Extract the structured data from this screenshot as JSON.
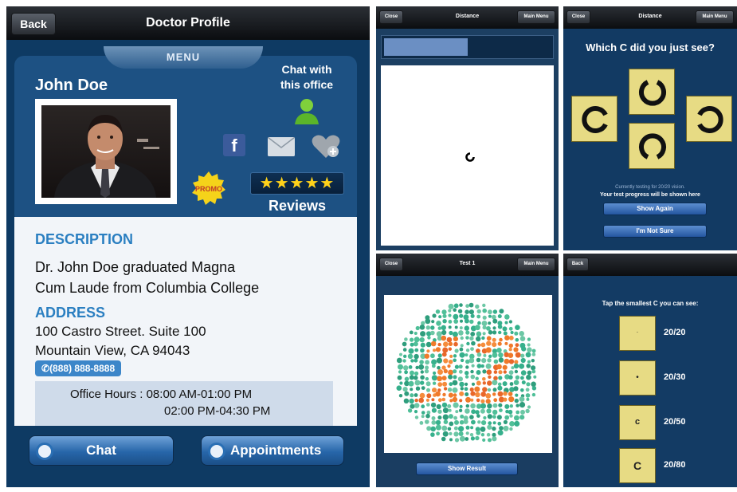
{
  "doctor_profile": {
    "nav": {
      "title": "Doctor Profile",
      "back_label": "Back"
    },
    "menu_label": "MENU",
    "name": "John Doe",
    "chat_with_office": [
      "Chat with",
      "this office"
    ],
    "promo_label": "PROMO",
    "rating": {
      "stars_text": "★★★★★",
      "value_out_of_5": 5,
      "label": "Reviews"
    },
    "description": {
      "heading": "DESCRIPTION",
      "lines": [
        "Dr. John Doe graduated Magna",
        "Cum Laude from Columbia College"
      ]
    },
    "address": {
      "heading": "ADDRESS",
      "lines": [
        "100 Castro Street. Suite 100",
        "Mountain View, CA 94043"
      ]
    },
    "phone": "(888) 888-8888",
    "office_hours": {
      "line1": "Office Hours : 08:00 AM-01:00 PM",
      "line2": "02:00 PM-04:30 PM"
    },
    "buttons": {
      "chat": "Chat",
      "appointments": "Appointments"
    },
    "icons": [
      "person-icon",
      "facebook-icon",
      "mail-icon",
      "favorite-add-icon",
      "chat-bubble-icon",
      "clock-icon"
    ]
  },
  "distance_test": {
    "nav": {
      "left": "Close",
      "title": "Distance",
      "right": "Main Menu"
    },
    "progress_fraction": 0.5
  },
  "which_c": {
    "nav": {
      "left": "Close",
      "title": "Distance",
      "right": "Main Menu"
    },
    "question": "Which C did you just see?",
    "info_line1": "Currently testing for 20/20 vision.",
    "info_line2": "Your test progress will be shown here",
    "show_again": "Show Again",
    "not_sure": "I'm Not Sure"
  },
  "color_test": {
    "nav": {
      "left": "Close",
      "title": "Test 1",
      "right": "Main Menu"
    },
    "plate_number": "12",
    "show_result": "Show Result",
    "colors": {
      "figure": "#f07a2a",
      "background_dots": "#36b08c"
    }
  },
  "acuity": {
    "nav": {
      "left": "Back"
    },
    "instruction": "Tap the smallest C you can see:",
    "rows": [
      {
        "glyph": "·",
        "label": "20/20"
      },
      {
        "glyph": "•",
        "label": "20/30"
      },
      {
        "glyph": "c",
        "label": "20/50"
      },
      {
        "glyph": "C",
        "label": "20/80"
      }
    ]
  }
}
